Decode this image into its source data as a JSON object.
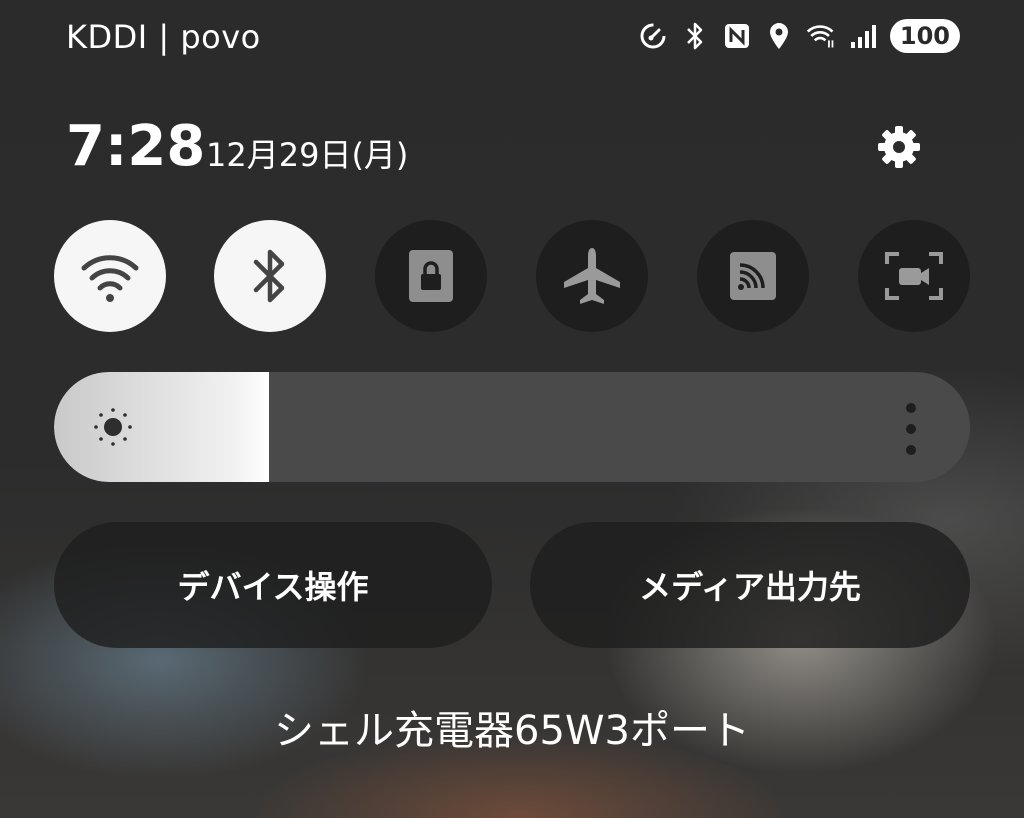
{
  "status_bar": {
    "carrier": "KDDI | povo",
    "battery_level": "100",
    "icons": [
      "data-saver-icon",
      "bluetooth-icon",
      "nfc-icon",
      "location-icon",
      "wifi-icon",
      "signal-icon"
    ]
  },
  "header": {
    "time": "7:28",
    "date": "12月29日(月)",
    "settings_icon": "gear-icon"
  },
  "quick_tiles": [
    {
      "id": "wifi",
      "icon": "wifi-icon",
      "active": true
    },
    {
      "id": "bluetooth",
      "icon": "bluetooth-icon",
      "active": true
    },
    {
      "id": "screen-lock",
      "icon": "lock-icon",
      "active": false
    },
    {
      "id": "airplane",
      "icon": "airplane-icon",
      "active": false
    },
    {
      "id": "cast",
      "icon": "cast-icon",
      "active": false
    },
    {
      "id": "screen-record",
      "icon": "screen-record-icon",
      "active": false
    }
  ],
  "brightness": {
    "level": 0.235,
    "icon": "sun-icon",
    "menu_icon": "more-vert-icon"
  },
  "buttons": {
    "device_control": "デバイス操作",
    "media_output": "メディア出力先"
  },
  "media": {
    "title": "シェル充電器65W3ポート"
  },
  "colors": {
    "tile_on": "#f6f6f6",
    "tile_off": "#1e1e1e",
    "icon_on": "#444444",
    "icon_off": "#9a9a9a"
  }
}
